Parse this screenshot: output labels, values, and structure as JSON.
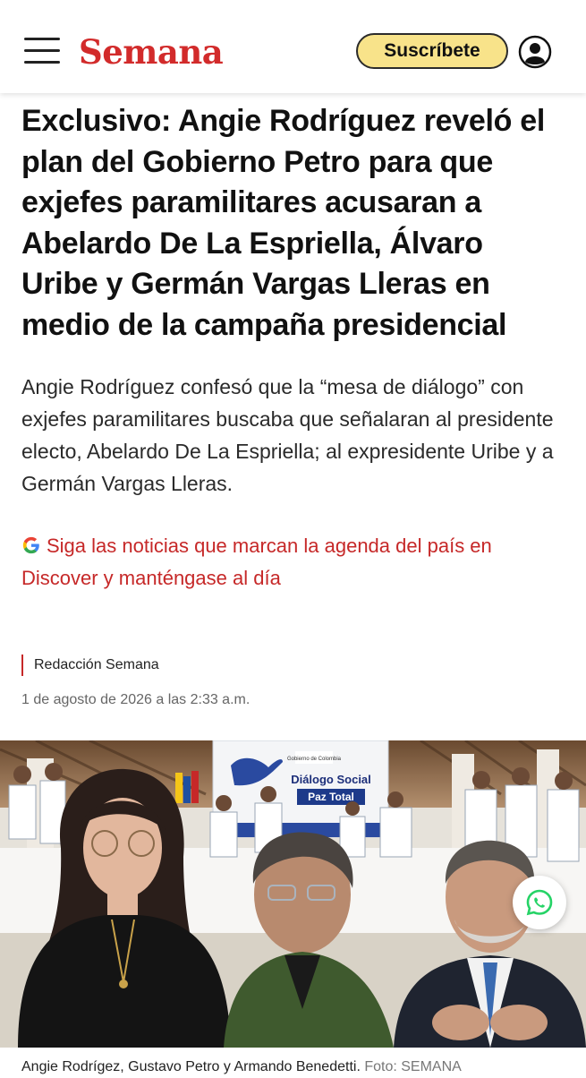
{
  "header": {
    "logo": "Semana",
    "subscribe_label": "Suscríbete",
    "menu_icon": "hamburger-menu-icon",
    "account_icon": "user-account-icon",
    "brand_color": "#d22b2b",
    "subscribe_color": "#f8e38a"
  },
  "article": {
    "headline": "Exclusivo: Angie Rodríguez reveló el plan del Gobierno Petro para que exjefes paramilitares acusaran a Abelardo De La Espriella, Álvaro Uribe y Germán Vargas Lleras en medio de la campaña presidencial",
    "summary": "Angie Rodríguez confesó que la “mesa de diálogo” con exjefes paramilitares buscaba que señalaran al presidente electo, Abelardo De La Espriella; al expresidente Uribe y a Germán Vargas Lleras.",
    "discover_link": "Siga las noticias que marcan la agenda del país en Discover y manténgase al día",
    "discover_icon": "google-icon",
    "author": "Redacción Semana",
    "date": "1 de agosto de 2026 a las 2:33 a.m.",
    "accent_color": "#c62828"
  },
  "photo": {
    "banner_title": "Diálogo Social",
    "banner_subtitle": "Paz Total",
    "banner_logo_text": "Gobierno de Colombia",
    "caption": "Angie Rodrígez, Gustavo Petro y Armando Benedetti.",
    "credit": "Foto: SEMANA"
  },
  "floating": {
    "whatsapp_icon": "whatsapp-icon",
    "whatsapp_color": "#25d366"
  }
}
